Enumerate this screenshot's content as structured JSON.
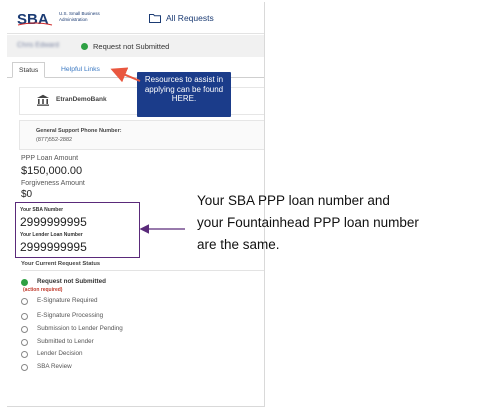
{
  "header": {
    "logo_text": "SBA",
    "logo_sub": "U.S. Small Business Administration",
    "all_requests": "All Requests",
    "brand_color": "#1b3b73"
  },
  "user_bar": {
    "user_name": "Chris Edward",
    "status": "Request not Submitted"
  },
  "tabs": [
    {
      "label": "Status"
    },
    {
      "label": "Helpful Links"
    }
  ],
  "callout": {
    "text": "Resources to assist in applying can be found HERE.",
    "color": "#1b3c8a"
  },
  "lender": {
    "bank_name": "EtranDemoBank",
    "phone_label": "General Support Phone Number:",
    "phone": "(877)552-2882"
  },
  "loan": {
    "amount_label": "PPP Loan Amount",
    "amount": "$150,000.00",
    "forgiveness_label": "Forgiveness Amount",
    "forgiveness": "$0",
    "sba_number_label": "Your SBA Number",
    "sba_number": "2999999995",
    "lender_number_label": "Your Lender Loan Number",
    "lender_number": "2999999995"
  },
  "current_status": {
    "title": "Your Current Request Status",
    "action_required": "(action required)",
    "steps": [
      "Request not Submitted",
      "E-Signature Required",
      "E-Signature Processing",
      "Submission to Lender Pending",
      "Submitted to Lender",
      "Lender Decision",
      "SBA Review"
    ]
  },
  "note": {
    "line1": "Your SBA PPP loan number and",
    "line2": "your Fountainhead PPP loan number",
    "line3": "are the same."
  },
  "colors": {
    "status_green": "#2ea043",
    "arrow_red": "#e9573f",
    "box_purple": "#5a2a7a"
  }
}
